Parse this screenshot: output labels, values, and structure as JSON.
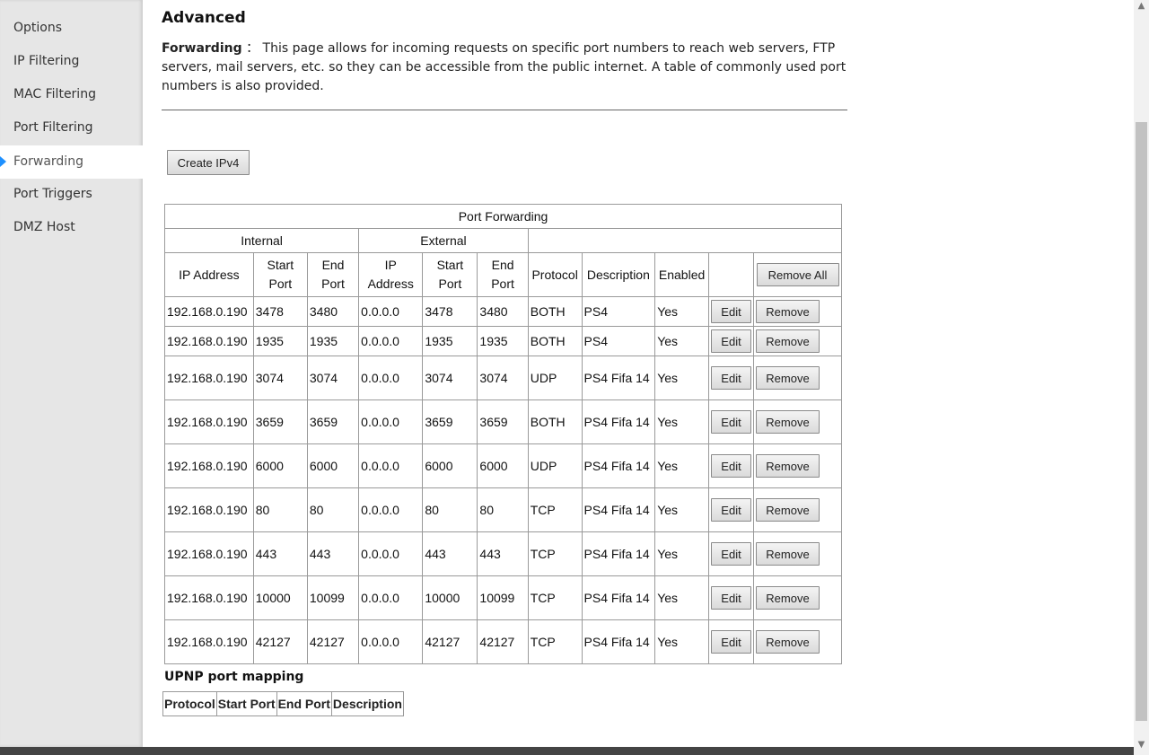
{
  "sidebar": {
    "items": [
      {
        "label": "Options",
        "active": false
      },
      {
        "label": "IP Filtering",
        "active": false
      },
      {
        "label": "MAC Filtering",
        "active": false
      },
      {
        "label": "Port Filtering",
        "active": false
      },
      {
        "label": "Forwarding",
        "active": true
      },
      {
        "label": "Port Triggers",
        "active": false
      },
      {
        "label": "DMZ Host",
        "active": false
      }
    ]
  },
  "page": {
    "title": "Advanced",
    "intro_label": "Forwarding",
    "intro_sep": "：",
    "intro_text": "This page allows for incoming requests on specific port numbers to reach web servers, FTP servers, mail servers, etc. so they can be accessible from the public internet. A table of commonly used port numbers is also provided.",
    "create_button": "Create IPv4"
  },
  "port_forwarding": {
    "title": "Port Forwarding",
    "group_internal": "Internal",
    "group_external": "External",
    "columns": {
      "int_ip": "IP Address",
      "int_start": "Start Port",
      "int_end": "End Port",
      "ext_ip": "IP Address",
      "ext_start": "Start Port",
      "ext_end": "End Port",
      "protocol": "Protocol",
      "description": "Description",
      "enabled": "Enabled"
    },
    "remove_all_label": "Remove All",
    "edit_label": "Edit",
    "remove_label": "Remove",
    "rows": [
      {
        "int_ip": "192.168.0.190",
        "int_start": "3478",
        "int_end": "3480",
        "ext_ip": "0.0.0.0",
        "ext_start": "3478",
        "ext_end": "3480",
        "protocol": "BOTH",
        "description": "PS4",
        "enabled": "Yes"
      },
      {
        "int_ip": "192.168.0.190",
        "int_start": "1935",
        "int_end": "1935",
        "ext_ip": "0.0.0.0",
        "ext_start": "1935",
        "ext_end": "1935",
        "protocol": "BOTH",
        "description": "PS4",
        "enabled": "Yes"
      },
      {
        "int_ip": "192.168.0.190",
        "int_start": "3074",
        "int_end": "3074",
        "ext_ip": "0.0.0.0",
        "ext_start": "3074",
        "ext_end": "3074",
        "protocol": "UDP",
        "description": "PS4 Fifa 14",
        "enabled": "Yes"
      },
      {
        "int_ip": "192.168.0.190",
        "int_start": "3659",
        "int_end": "3659",
        "ext_ip": "0.0.0.0",
        "ext_start": "3659",
        "ext_end": "3659",
        "protocol": "BOTH",
        "description": "PS4 Fifa 14",
        "enabled": "Yes"
      },
      {
        "int_ip": "192.168.0.190",
        "int_start": "6000",
        "int_end": "6000",
        "ext_ip": "0.0.0.0",
        "ext_start": "6000",
        "ext_end": "6000",
        "protocol": "UDP",
        "description": "PS4 Fifa 14",
        "enabled": "Yes"
      },
      {
        "int_ip": "192.168.0.190",
        "int_start": "80",
        "int_end": "80",
        "ext_ip": "0.0.0.0",
        "ext_start": "80",
        "ext_end": "80",
        "protocol": "TCP",
        "description": "PS4 Fifa 14",
        "enabled": "Yes"
      },
      {
        "int_ip": "192.168.0.190",
        "int_start": "443",
        "int_end": "443",
        "ext_ip": "0.0.0.0",
        "ext_start": "443",
        "ext_end": "443",
        "protocol": "TCP",
        "description": "PS4 Fifa 14",
        "enabled": "Yes"
      },
      {
        "int_ip": "192.168.0.190",
        "int_start": "10000",
        "int_end": "10099",
        "ext_ip": "0.0.0.0",
        "ext_start": "10000",
        "ext_end": "10099",
        "protocol": "TCP",
        "description": "PS4 Fifa 14",
        "enabled": "Yes"
      },
      {
        "int_ip": "192.168.0.190",
        "int_start": "42127",
        "int_end": "42127",
        "ext_ip": "0.0.0.0",
        "ext_start": "42127",
        "ext_end": "42127",
        "protocol": "TCP",
        "description": "PS4 Fifa 14",
        "enabled": "Yes"
      }
    ]
  },
  "upnp": {
    "title": "UPNP port mapping",
    "columns": [
      "Protocol",
      "Start Port",
      "End Port",
      "Description"
    ]
  },
  "colors": {
    "sidebar_bg": "#e6e6e6",
    "active_marker": "#1e90ff",
    "bottom_bar": "#444444"
  }
}
